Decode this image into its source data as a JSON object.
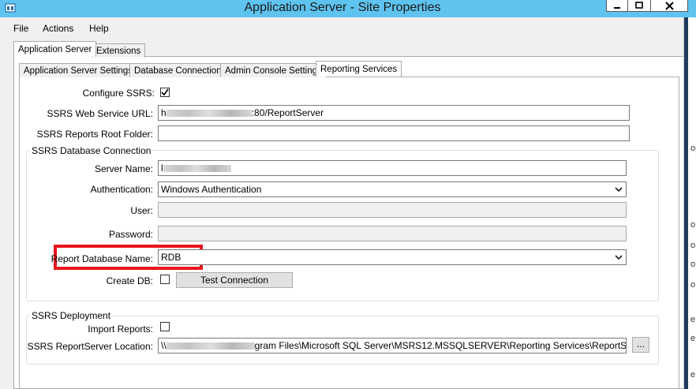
{
  "window": {
    "title": "Application Server - Site Properties",
    "controls": {
      "minimize": "minimize",
      "maximize": "maximize",
      "close": "close"
    }
  },
  "menu": [
    "File",
    "Actions",
    "Help"
  ],
  "outer_tabs": [
    {
      "label": "Application Server",
      "active": true
    },
    {
      "label": "Extensions",
      "active": false
    }
  ],
  "inner_tabs": [
    {
      "label": "Application Server Settings",
      "active": false
    },
    {
      "label": "Database Connection",
      "active": false
    },
    {
      "label": "Admin Console Settings",
      "active": false
    },
    {
      "label": "Reporting Services",
      "active": true
    }
  ],
  "ssrs": {
    "configure_label": "Configure SSRS:",
    "configure_checked": true,
    "url_label": "SSRS Web Service URL:",
    "url_prefix": "h",
    "url_suffix": ":80/ReportServer",
    "root_label": "SSRS Reports Root Folder:",
    "root_value": ""
  },
  "db_group": {
    "title": "SSRS Database Connection",
    "server_label": "Server Name:",
    "server_prefix": "l",
    "auth_label": "Authentication:",
    "auth_value": "Windows Authentication",
    "user_label": "User:",
    "password_label": "Password:",
    "report_db_label": "Report Database Name:",
    "report_db_value": "RDB",
    "create_db_label": "Create DB:",
    "create_db_checked": false,
    "test_button": "Test Connection",
    "highlight_color": "#e8141c"
  },
  "deploy_group": {
    "title": "SSRS Deployment",
    "import_label": "Import Reports:",
    "import_checked": false,
    "location_label": "SSRS ReportServer Location:",
    "location_prefix": "\\\\",
    "location_mid": "g",
    "location_suffix": "ram Files\\Microsoft SQL Server\\MSRS12.MSSQLSERVER\\Reporting Services\\ReportServer",
    "browse_button": "..."
  },
  "background_window_chars": [
    "op",
    "o",
    "o",
    "o",
    "o",
    "e",
    "e",
    "e"
  ],
  "colors": {
    "titlebar": "#5fc3ef",
    "highlight": "#e8141c"
  }
}
